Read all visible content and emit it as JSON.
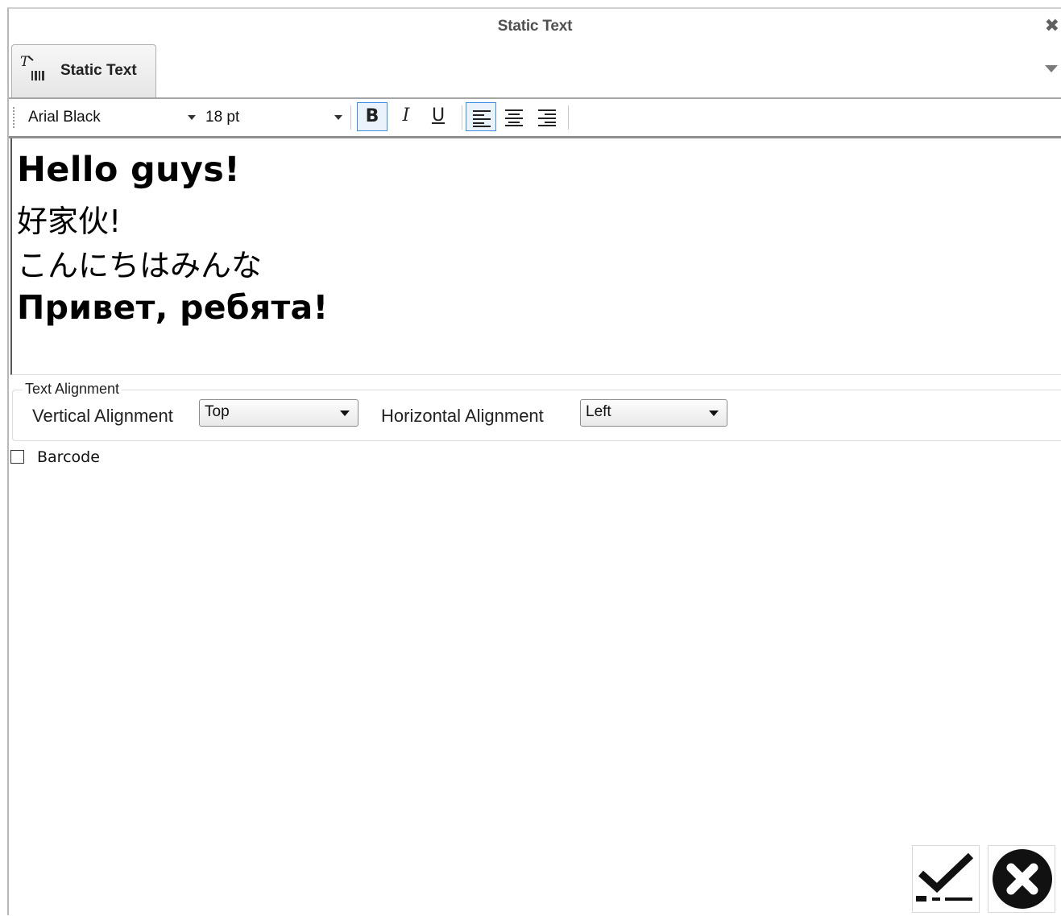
{
  "window": {
    "title": "Static Text"
  },
  "tab": {
    "label": "Static Text",
    "icon": "static-text-icon"
  },
  "toolbar": {
    "font": "Arial Black",
    "size": "18 pt",
    "bold": "B",
    "italic": "I",
    "underline": "U",
    "bold_active": true,
    "align_left_active": true
  },
  "editor": {
    "lines": [
      "Hello guys!",
      "好家伙!",
      "こんにちはみんな",
      "Привет, ребята!"
    ]
  },
  "text_alignment": {
    "legend": "Text Alignment",
    "vertical_label": "Vertical Alignment",
    "vertical_value": "Top",
    "horizontal_label": "Horizontal Alignment",
    "horizontal_value": "Left"
  },
  "barcode": {
    "label": "Barcode",
    "checked": false
  },
  "actions": {
    "ok_icon": "checkmark-icon",
    "cancel_icon": "cancel-circle-icon"
  }
}
